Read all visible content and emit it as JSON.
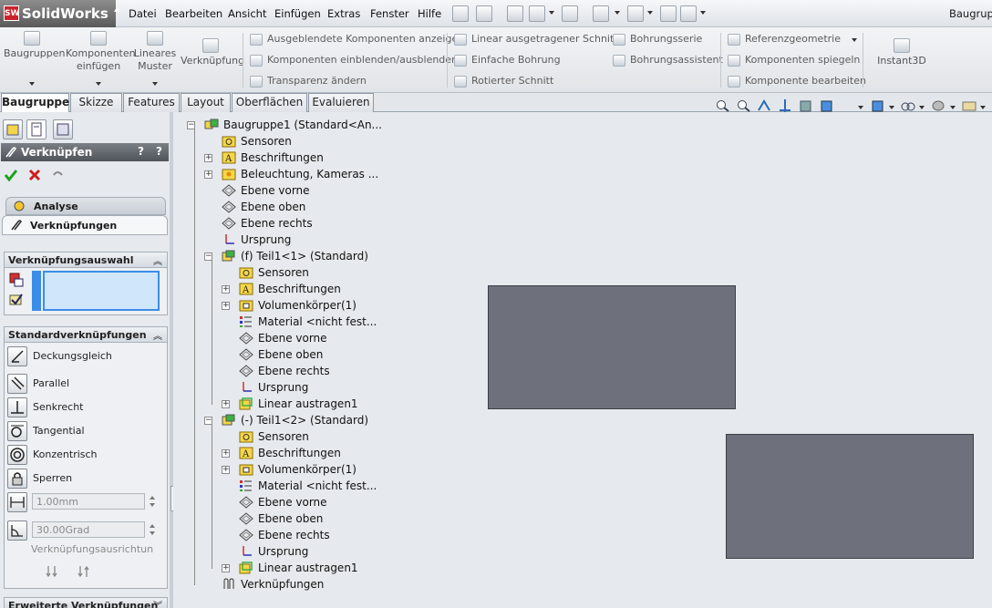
{
  "app": {
    "name": "SolidWorks",
    "logo_mark": "SW",
    "doc_title": "Baugrup"
  },
  "menu": [
    "Datei",
    "Bearbeiten",
    "Ansicht",
    "Einfügen",
    "Extras",
    "Fenster",
    "Hilfe"
  ],
  "ribbon": {
    "big": [
      {
        "label": "Baugruppen",
        "icon": "assembly-icon"
      },
      {
        "label": "Komponenten einfügen",
        "icon": "insert-component-icon"
      },
      {
        "label": "Lineares Muster",
        "icon": "linear-pattern-icon"
      },
      {
        "label": "Verknüpfung",
        "icon": "mate-icon"
      }
    ],
    "col1": [
      "Ausgeblendete Komponenten anzeigen",
      "Komponenten einblenden/ausblenden",
      "Transparenz ändern"
    ],
    "col2": [
      "Linear ausgetragener Schnitt",
      "Einfache Bohrung",
      "Rotierter Schnitt"
    ],
    "col3": [
      "Bohrungsserie",
      "Bohrungsassistent"
    ],
    "col4": [
      "Referenzgeometrie",
      "Komponenten spiegeln",
      "Komponente bearbeiten"
    ],
    "instant3d": "Instant3D"
  },
  "tabs": [
    "Baugruppe",
    "Skizze",
    "Features",
    "Layout",
    "Oberflächen",
    "Evaluieren"
  ],
  "left": {
    "title": "Verknüpfen",
    "help": "?",
    "subtabs": [
      "Analyse",
      "Verknüpfungen"
    ],
    "selection_title": "Verknüpfungsauswahl",
    "standard_title": "Standardverknüpfungen",
    "mates": [
      "Deckungsgleich",
      "Parallel",
      "Senkrecht",
      "Tangential",
      "Konzentrisch",
      "Sperren"
    ],
    "distance_value": "1.00mm",
    "angle_value": "30.00Grad",
    "alignment_label": "Verknüpfungsausrichtun",
    "advanced_title": "Erweiterte Verknüpfungen"
  },
  "tree": [
    {
      "label": "Baugruppe1  (Standard<An...",
      "level": 0,
      "expand": "-",
      "icon": "assembly-icon"
    },
    {
      "label": "Sensoren",
      "level": 1,
      "expand": "",
      "icon": "sensor-icon"
    },
    {
      "label": "Beschriftungen",
      "level": 1,
      "expand": "+",
      "icon": "annotation-icon"
    },
    {
      "label": "Beleuchtung, Kameras ...",
      "level": 1,
      "expand": "+",
      "icon": "lights-icon"
    },
    {
      "label": "Ebene vorne",
      "level": 1,
      "expand": "",
      "icon": "plane-icon"
    },
    {
      "label": "Ebene oben",
      "level": 1,
      "expand": "",
      "icon": "plane-icon"
    },
    {
      "label": "Ebene rechts",
      "level": 1,
      "expand": "",
      "icon": "plane-icon"
    },
    {
      "label": "Ursprung",
      "level": 1,
      "expand": "",
      "icon": "origin-icon"
    },
    {
      "label": "(f) Teil1<1> (Standard)",
      "level": 1,
      "expand": "-",
      "icon": "part-icon"
    },
    {
      "label": "Sensoren",
      "level": 2,
      "expand": "",
      "icon": "sensor-icon"
    },
    {
      "label": "Beschriftungen",
      "level": 2,
      "expand": "+",
      "icon": "annotation-icon"
    },
    {
      "label": "Volumenkörper(1)",
      "level": 2,
      "expand": "+",
      "icon": "solid-body-icon"
    },
    {
      "label": "Material <nicht fest...",
      "level": 2,
      "expand": "",
      "icon": "material-icon"
    },
    {
      "label": "Ebene vorne",
      "level": 2,
      "expand": "",
      "icon": "plane-icon"
    },
    {
      "label": "Ebene oben",
      "level": 2,
      "expand": "",
      "icon": "plane-icon"
    },
    {
      "label": "Ebene rechts",
      "level": 2,
      "expand": "",
      "icon": "plane-icon"
    },
    {
      "label": "Ursprung",
      "level": 2,
      "expand": "",
      "icon": "origin-icon"
    },
    {
      "label": "Linear austragen1",
      "level": 2,
      "expand": "+",
      "icon": "extrude-icon"
    },
    {
      "label": "(-) Teil1<2> (Standard)",
      "level": 1,
      "expand": "-",
      "icon": "part-icon"
    },
    {
      "label": "Sensoren",
      "level": 2,
      "expand": "",
      "icon": "sensor-icon"
    },
    {
      "label": "Beschriftungen",
      "level": 2,
      "expand": "+",
      "icon": "annotation-icon"
    },
    {
      "label": "Volumenkörper(1)",
      "level": 2,
      "expand": "+",
      "icon": "solid-body-icon"
    },
    {
      "label": "Material <nicht fest...",
      "level": 2,
      "expand": "",
      "icon": "material-icon"
    },
    {
      "label": "Ebene vorne",
      "level": 2,
      "expand": "",
      "icon": "plane-icon"
    },
    {
      "label": "Ebene oben",
      "level": 2,
      "expand": "",
      "icon": "plane-icon"
    },
    {
      "label": "Ebene rechts",
      "level": 2,
      "expand": "",
      "icon": "plane-icon"
    },
    {
      "label": "Ursprung",
      "level": 2,
      "expand": "",
      "icon": "origin-icon"
    },
    {
      "label": "Linear austragen1",
      "level": 2,
      "expand": "+",
      "icon": "extrude-icon"
    },
    {
      "label": "Verknüpfungen",
      "level": 1,
      "expand": "",
      "icon": "mates-folder-icon"
    }
  ],
  "colors": {
    "part_face": "#6e717c",
    "accept": "#1aa31a",
    "cancel": "#cc1f1f",
    "folder": "#f5d64a"
  }
}
